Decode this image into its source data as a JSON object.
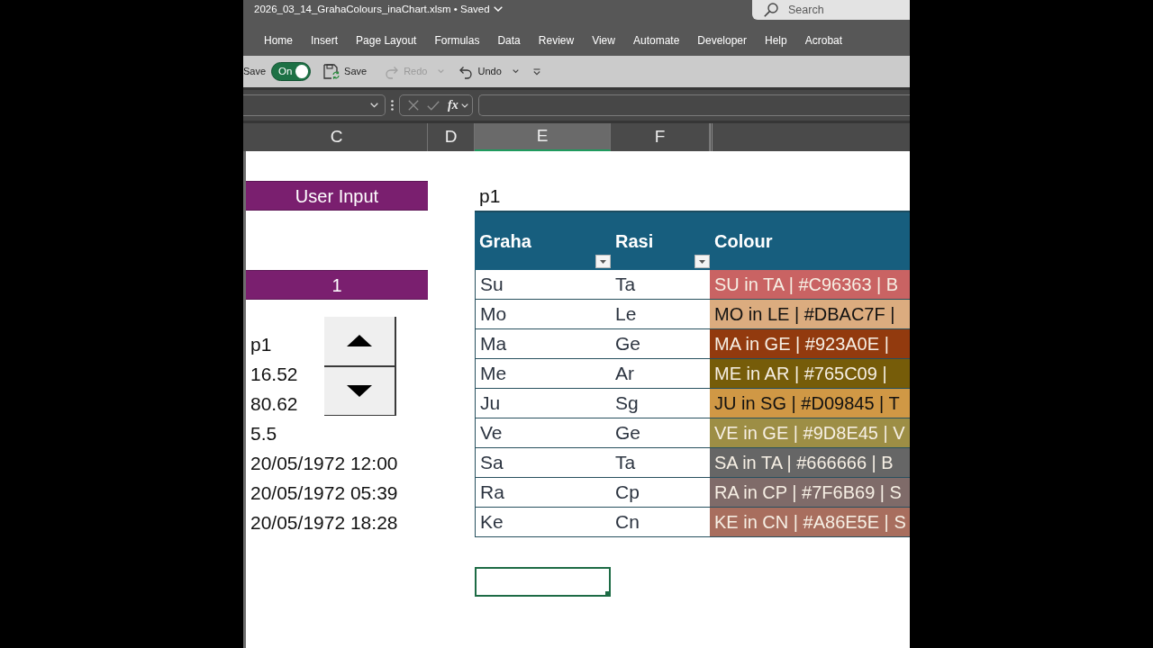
{
  "window": {
    "title": "2026_03_14_GrahaColours_inaChart.xlsm • Saved"
  },
  "search": {
    "placeholder": "Search"
  },
  "ribbon_tabs": [
    {
      "label": "Home",
      "selected": false
    },
    {
      "label": "Insert",
      "selected": false
    },
    {
      "label": "Page Layout",
      "selected": false
    },
    {
      "label": "Formulas",
      "selected": false
    },
    {
      "label": "Data",
      "selected": false
    },
    {
      "label": "Review",
      "selected": false
    },
    {
      "label": "View",
      "selected": false
    },
    {
      "label": "Automate",
      "selected": false
    },
    {
      "label": "Developer",
      "selected": false
    },
    {
      "label": "Help",
      "selected": false
    },
    {
      "label": "Acrobat",
      "selected": false
    }
  ],
  "quick_access": [
    {
      "kind": "autosave",
      "label": "Save",
      "toggle": "On",
      "on": true
    },
    {
      "kind": "save",
      "label": "Save",
      "disabled": false,
      "menu": false
    },
    {
      "kind": "redo",
      "label": "Redo",
      "disabled": true,
      "menu": true
    },
    {
      "kind": "undo",
      "label": "Undo",
      "disabled": false,
      "menu": true
    },
    {
      "kind": "customize"
    }
  ],
  "formula_bar": {
    "function_label": "fx",
    "editing": false
  },
  "columns": [
    {
      "label": "C",
      "selected": false
    },
    {
      "label": "D",
      "selected": false
    },
    {
      "label": "E",
      "selected": true
    },
    {
      "label": "F",
      "selected": false
    }
  ],
  "sheet": {
    "input_header": "User Input",
    "input_value": "1",
    "table_label": "p1",
    "parameters": [
      "p1",
      "16.52",
      "80.62",
      "5.5",
      "20/05/1972 12:00",
      "20/05/1972 05:39",
      "20/05/1972 18:28"
    ],
    "table": {
      "columns": [
        {
          "label": "Graha",
          "filter": true
        },
        {
          "label": "Rasi",
          "filter": true
        },
        {
          "label": "Colour",
          "filter": false
        }
      ],
      "rows": [
        {
          "graha": "Su",
          "rasi": "Ta",
          "colour": "SU in TA | #C96363 | B",
          "color": "#c96363"
        },
        {
          "graha": "Mo",
          "rasi": "Le",
          "colour": "MO in LE | #DBAC7F |",
          "color": "#dbac7f"
        },
        {
          "graha": "Ma",
          "rasi": "Ge",
          "colour": "MA in GE | #923A0E |",
          "color": "#923a0e"
        },
        {
          "graha": "Me",
          "rasi": "Ar",
          "colour": "ME in AR | #765C09 |",
          "color": "#765c09"
        },
        {
          "graha": "Ju",
          "rasi": "Sg",
          "colour": "JU in SG | #D09845 | T",
          "color": "#d09845"
        },
        {
          "graha": "Ve",
          "rasi": "Ge",
          "colour": "VE in GE | #9D8E45 | V",
          "color": "#9d8e45"
        },
        {
          "graha": "Sa",
          "rasi": "Ta",
          "colour": "SA in TA | #666666 | B",
          "color": "#666666"
        },
        {
          "graha": "Ra",
          "rasi": "Cp",
          "colour": "RA in CP | #7F6B69 | S",
          "color": "#7f6b69"
        },
        {
          "graha": "Ke",
          "rasi": "Cn",
          "colour": "KE in CN | #A86E5E | S",
          "color": "#a86e5e"
        }
      ]
    }
  }
}
